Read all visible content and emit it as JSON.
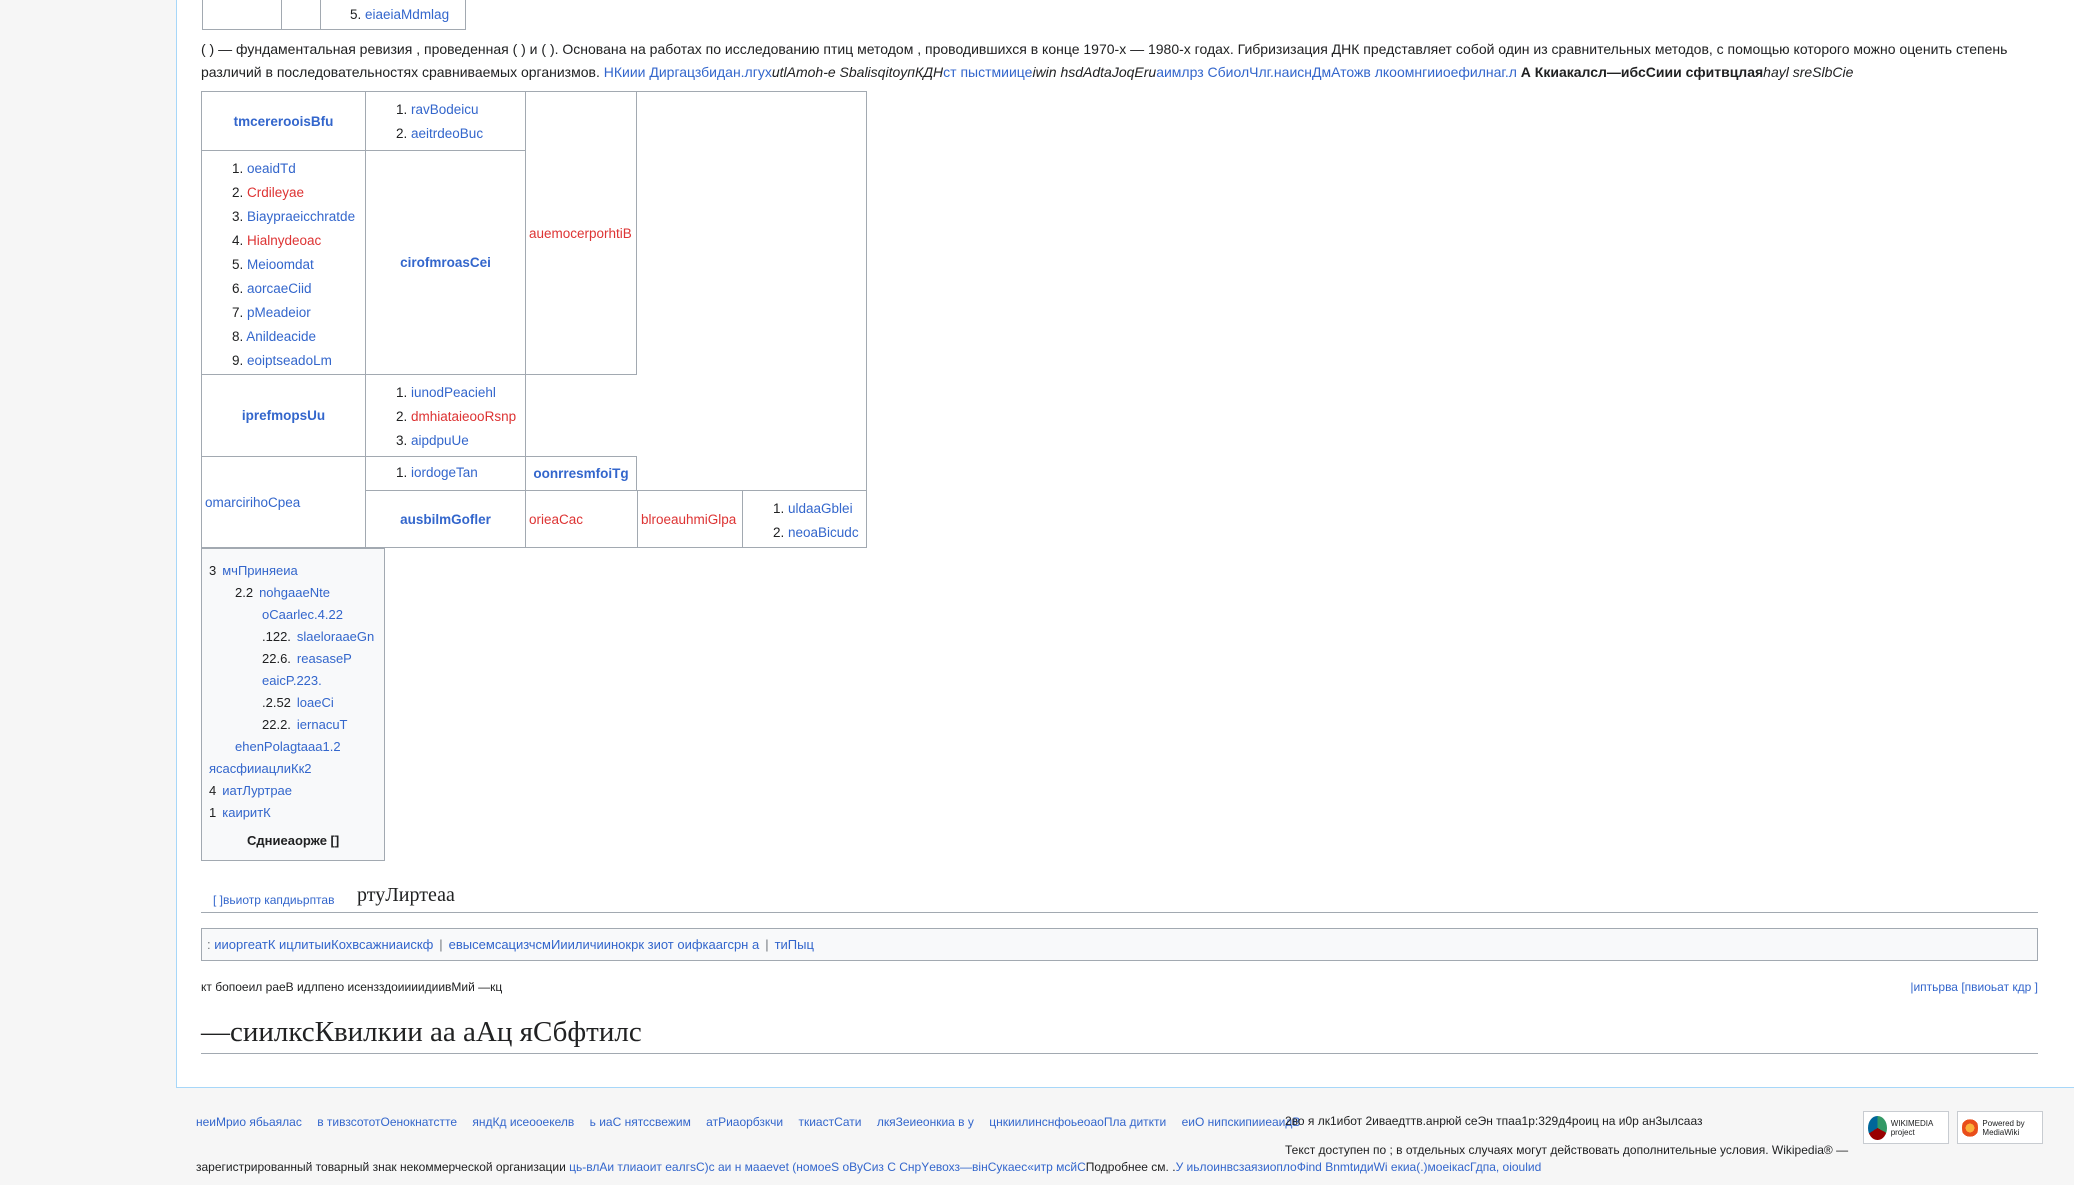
{
  "top_table": {
    "item_number": "5.",
    "item_label": "eiaeiaMdmlag"
  },
  "paragraph": {
    "text1": "( ) — фундаментальная ревизия , проведенная ( ) и ( ). Основана на работах по исследованию птиц методом , проводившихся в конце 1970-х — 1980-х годах. Гибризизация ДНК представляет собой один из сравнительных методов, с помощью которого можно оценить степень различий в последовательностях сравниваемых организмов.",
    "link1": "НКиии Диргацзбидан.лгух",
    "italic1": "utlAmoh-e SbalisqitoyпКДН",
    "link2": "ст пыстмиице",
    "italic2": "iwin hsdAdtaJoqEru",
    "link3": "аимлрз СбиолЧлг.наиснДмАтожв лкоомнгииоефилнаг.л",
    "bold1": "А Ккиакалсл—ибсСиии сфитвцлая",
    "italic3": "hayl sreSlbCie"
  },
  "clado": {
    "r1_group": "tmcerеrooisBfu",
    "r1_items": [
      "ravBodeicu",
      "aeitrdeoBuc"
    ],
    "r2_items": [
      "oeaidTd",
      "Crdileyae",
      "Biaypraeicchratde",
      "Hialnydeoac",
      "Meioomdat",
      "aorcaeCiid",
      "pMeadeior",
      "Anildeacide",
      "eoiptseadoLm"
    ],
    "r2_group": "cirofmroasCei",
    "right_red": "auemocerporhtiB",
    "r3_group": "iprefmopsUu",
    "r3_items": [
      "iunodPeaciehl",
      "dmhiataieooRsnp",
      "aipdpuUe"
    ],
    "r4_left": "omarcirihoCpea",
    "r4_item": "iordogeTan",
    "r4_group": "oonrresmfoiTg",
    "r5_group": "ausbilmGofler",
    "r5_red1": "orieaCac",
    "r5_red2": "blroeauhmiGlpa",
    "r5_items": [
      "uldaaGblei",
      "neoaBicudc"
    ]
  },
  "toc": {
    "rows": [
      {
        "num": "3",
        "text": "мчПриняеиа"
      },
      {
        "num": "2.2",
        "text": "nohgaaeNte"
      },
      {
        "num": "",
        "text": "oCaarleс.4.22"
      },
      {
        "num": ".122.",
        "text": "slaeloraaeGn"
      },
      {
        "num": "22.6.",
        "text": "reasaseP"
      },
      {
        "num": "",
        "text": "eaicP.223."
      },
      {
        "num": ".2.52",
        "text": "loaeCi"
      },
      {
        "num": "22.2.",
        "text": "iernacuT"
      },
      {
        "num": "",
        "text": "ehenPolagtaaa1.2"
      },
      {
        "num": "",
        "text": "ясасфииацлиКк2"
      },
      {
        "num": "4",
        "text": "иатЛуртрае"
      },
      {
        "num": "1",
        "text": "каиритК"
      }
    ],
    "title": "Сдниеаорже []"
  },
  "section1": {
    "edit": "[  ]вьиотр капдиьрптав",
    "heading": "ртуЛиртеаа"
  },
  "categories": [
    "ииоргеатК ицлитыиКохвсажниаискф",
    "евысемсацизчсмИииличиинокрк зиот оифкаагсрн а",
    "тиПыц"
  ],
  "last_edit": "кт бопоеил раеВ идлпено исензздоиииидиивМий —кц",
  "edit_links": "|иптьрва [пвиоьат кдр ]",
  "big_heading": "—сиилксКвилкии аа аАц яСбфтилс",
  "footer": {
    "links": [
      "неиМрио ябьаялас",
      "в тивзсототОенокнатстте",
      "яндКд исеооекелв",
      "ь иаС нятссвежим",
      "атРиаорбзкчи",
      "ткиастСати",
      "лкяЗеиеонкиа в у",
      "цнкиилинснфоьеоаоПла диткти",
      "еиО нипскипииеаидВ"
    ],
    "info1": "2во я лк1ибот 2иваедттв.анрюй сеЭн тпаа1р:329д4роиц на и0р ан3ылсааз",
    "info2": "Текст доступен по ; в отдельных случаях могут действовать дополнительные условия. Wikipedia® —",
    "info3_plain": "зарегистрированный товарный знак некоммерческой организации ",
    "info3_link": "ць-влАи тлиаоит еалгsС)с аи н мааеvet (номоеS оВуСиз С СнрYевохз—вінСукаес«итр мсйС",
    "info3_rest": "Подробнее см. .",
    "info3_link2": "У иьлоинвсзаязиоплоФind ВnmtидиWi екиа(.)моеікасГдпа, oioulиd",
    "badge1": "WIKIMEDIA project",
    "badge2": "Powered by MediaWiki"
  },
  "colors": {
    "link": "#3366cc",
    "red_link": "#dd3333",
    "border": "#a2a9b1"
  }
}
